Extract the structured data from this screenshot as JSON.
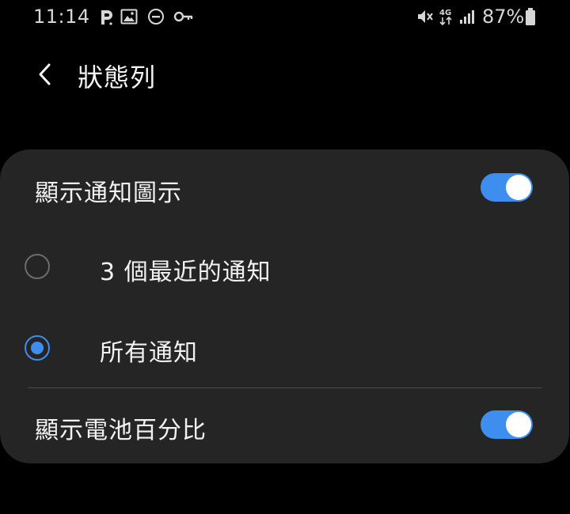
{
  "status_bar": {
    "time": "11:14",
    "battery_percent": "87%",
    "left_icons": [
      "p-icon",
      "image-icon",
      "do-not-disturb-icon",
      "key-icon"
    ],
    "right_icons": [
      "mute-icon",
      "4g-data-icon",
      "signal-icon",
      "battery-icon"
    ],
    "network_label": "4G"
  },
  "header": {
    "title": "狀態列"
  },
  "settings": {
    "show_notification_icons": {
      "label": "顯示通知圖示",
      "enabled": true
    },
    "options": [
      {
        "label": "3 個最近的通知",
        "selected": false
      },
      {
        "label": "所有通知",
        "selected": true
      }
    ],
    "show_battery_percentage": {
      "label": "顯示電池百分比",
      "enabled": true
    }
  },
  "colors": {
    "accent": "#3e8ef0",
    "card_background": "#252525",
    "background": "#000000"
  }
}
